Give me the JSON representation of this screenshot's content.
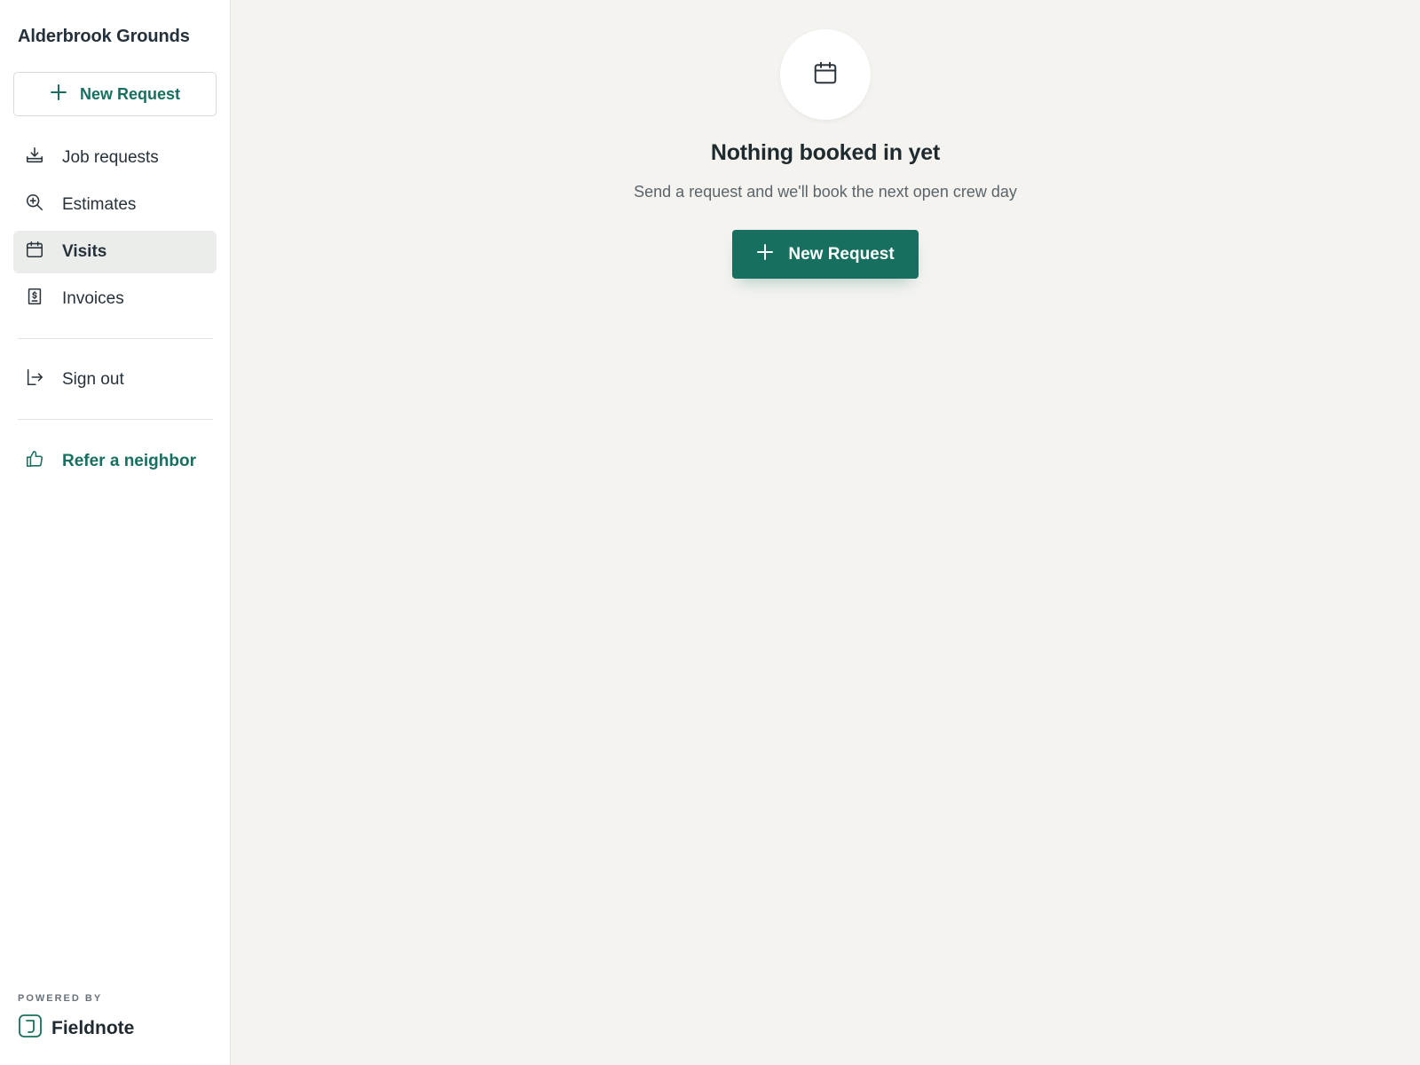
{
  "sidebar": {
    "brand": "Alderbrook Grounds",
    "new_request_label": "New Request",
    "nav": [
      {
        "label": "Job requests",
        "icon": "inbox-download-icon"
      },
      {
        "label": "Estimates",
        "icon": "magnify-plus-icon"
      },
      {
        "label": "Visits",
        "icon": "calendar-icon",
        "active": true
      },
      {
        "label": "Invoices",
        "icon": "receipt-dollar-icon"
      }
    ],
    "sign_out_label": "Sign out",
    "refer_label": "Refer a neighbor",
    "powered_by": "POWERED BY",
    "powered_brand": "Fieldnote"
  },
  "empty_state": {
    "icon": "calendar-icon",
    "title": "Nothing booked in yet",
    "subtitle": "Send a request and we'll book the next open crew day",
    "button_label": "New Request"
  },
  "colors": {
    "accent": "#17705f",
    "background": "#f4f3f0",
    "sidebar": "#ffffff",
    "active_item": "#ebedeb"
  }
}
